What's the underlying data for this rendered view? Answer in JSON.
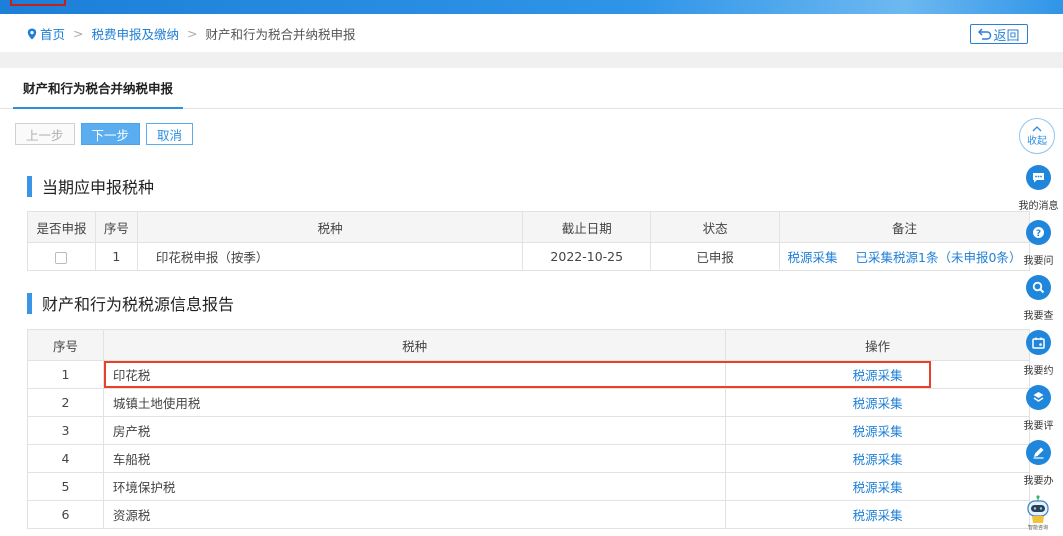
{
  "breadcrumb": {
    "home": "首页",
    "level2": "税费申报及缴纳",
    "current": "财产和行为税合并纳税申报",
    "back_label": "返回"
  },
  "tab": {
    "label": "财产和行为税合并纳税申报"
  },
  "buttons": {
    "prev": "上一步",
    "next": "下一步",
    "cancel": "取消"
  },
  "section1": {
    "title": "当期应申报税种",
    "headers": [
      "是否申报",
      "序号",
      "税种",
      "截止日期",
      "状态",
      "备注"
    ],
    "rows": [
      {
        "index": "1",
        "tax": "印花税申报（按季）",
        "deadline": "2022-10-25",
        "status": "已申报",
        "remark_link": "税源采集",
        "remark_text": "已采集税源1条（未申报0条）"
      }
    ]
  },
  "section2": {
    "title": "财产和行为税税源信息报告",
    "headers": [
      "序号",
      "税种",
      "操作"
    ],
    "rows": [
      {
        "index": "1",
        "tax": "印花税",
        "action": "税源采集"
      },
      {
        "index": "2",
        "tax": "城镇土地使用税",
        "action": "税源采集"
      },
      {
        "index": "3",
        "tax": "房产税",
        "action": "税源采集"
      },
      {
        "index": "4",
        "tax": "车船税",
        "action": "税源采集"
      },
      {
        "index": "5",
        "tax": "环境保护税",
        "action": "税源采集"
      },
      {
        "index": "6",
        "tax": "资源税",
        "action": "税源采集"
      }
    ]
  },
  "right_rail": {
    "collapse_label": "收起",
    "items": [
      {
        "label": "我的消息",
        "icon": "message-icon"
      },
      {
        "label": "我要问",
        "icon": "question-icon"
      },
      {
        "label": "我要查",
        "icon": "search-icon"
      },
      {
        "label": "我要约",
        "icon": "calendar-icon"
      },
      {
        "label": "我要评",
        "icon": "rate-icon"
      },
      {
        "label": "我要办",
        "icon": "edit-icon"
      }
    ],
    "assistant_label": "智能咨询"
  },
  "colors": {
    "accent": "#1f86db",
    "highlight": "#e8412b",
    "link": "#1f7fd6"
  }
}
